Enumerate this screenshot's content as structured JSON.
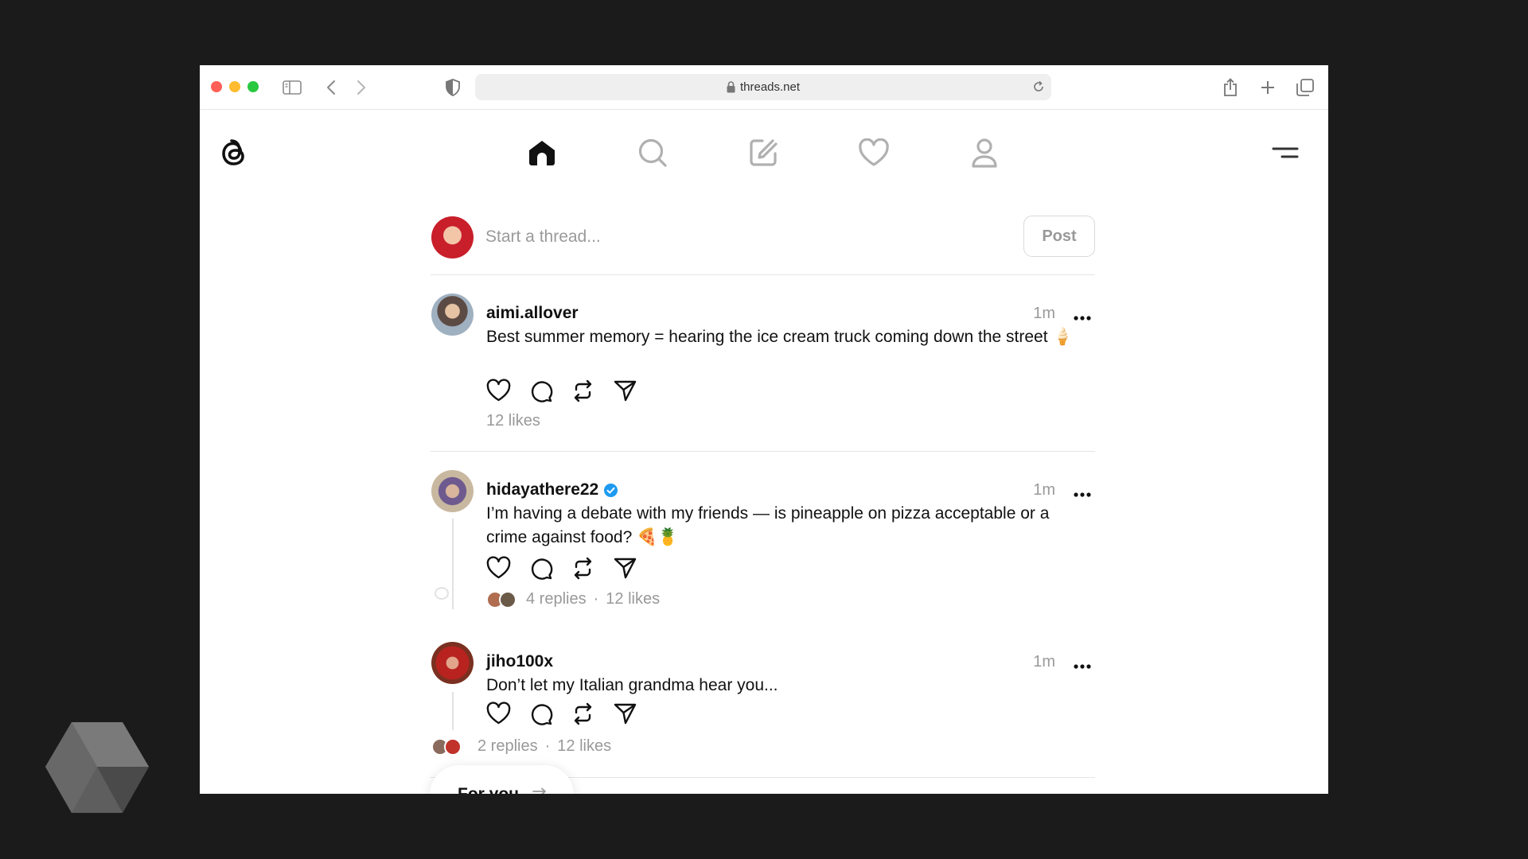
{
  "browser": {
    "url": "threads.net"
  },
  "composer": {
    "placeholder": "Start a thread...",
    "post_label": "Post"
  },
  "posts": [
    {
      "username": "aimi.allover",
      "verified": false,
      "time": "1m",
      "text": "Best summer memory = hearing the ice cream truck coming down the street 🍦",
      "likes": "12 likes",
      "replies": ""
    },
    {
      "username": "hidayathere22",
      "verified": true,
      "time": "1m",
      "text": "I’m having a debate with my friends — is pineapple on pizza acceptable or a crime against food? 🍕🍍",
      "likes": "12 likes",
      "replies": "4 replies"
    },
    {
      "username": "jiho100x",
      "verified": false,
      "time": "1m",
      "text": "Don’t let my Italian grandma hear you...",
      "likes": "12 likes",
      "replies": "2 replies"
    }
  ],
  "feed_switcher": {
    "label": "For you"
  },
  "icons": {
    "nav": [
      "home-icon",
      "search-icon",
      "compose-icon",
      "heart-icon",
      "profile-icon"
    ],
    "actions": [
      "like-icon",
      "reply-icon",
      "repost-icon",
      "share-icon"
    ]
  },
  "colors": {
    "verified": "#1d9bf0",
    "text": "#111111",
    "muted": "#999999",
    "background": "#1b1b1b"
  }
}
